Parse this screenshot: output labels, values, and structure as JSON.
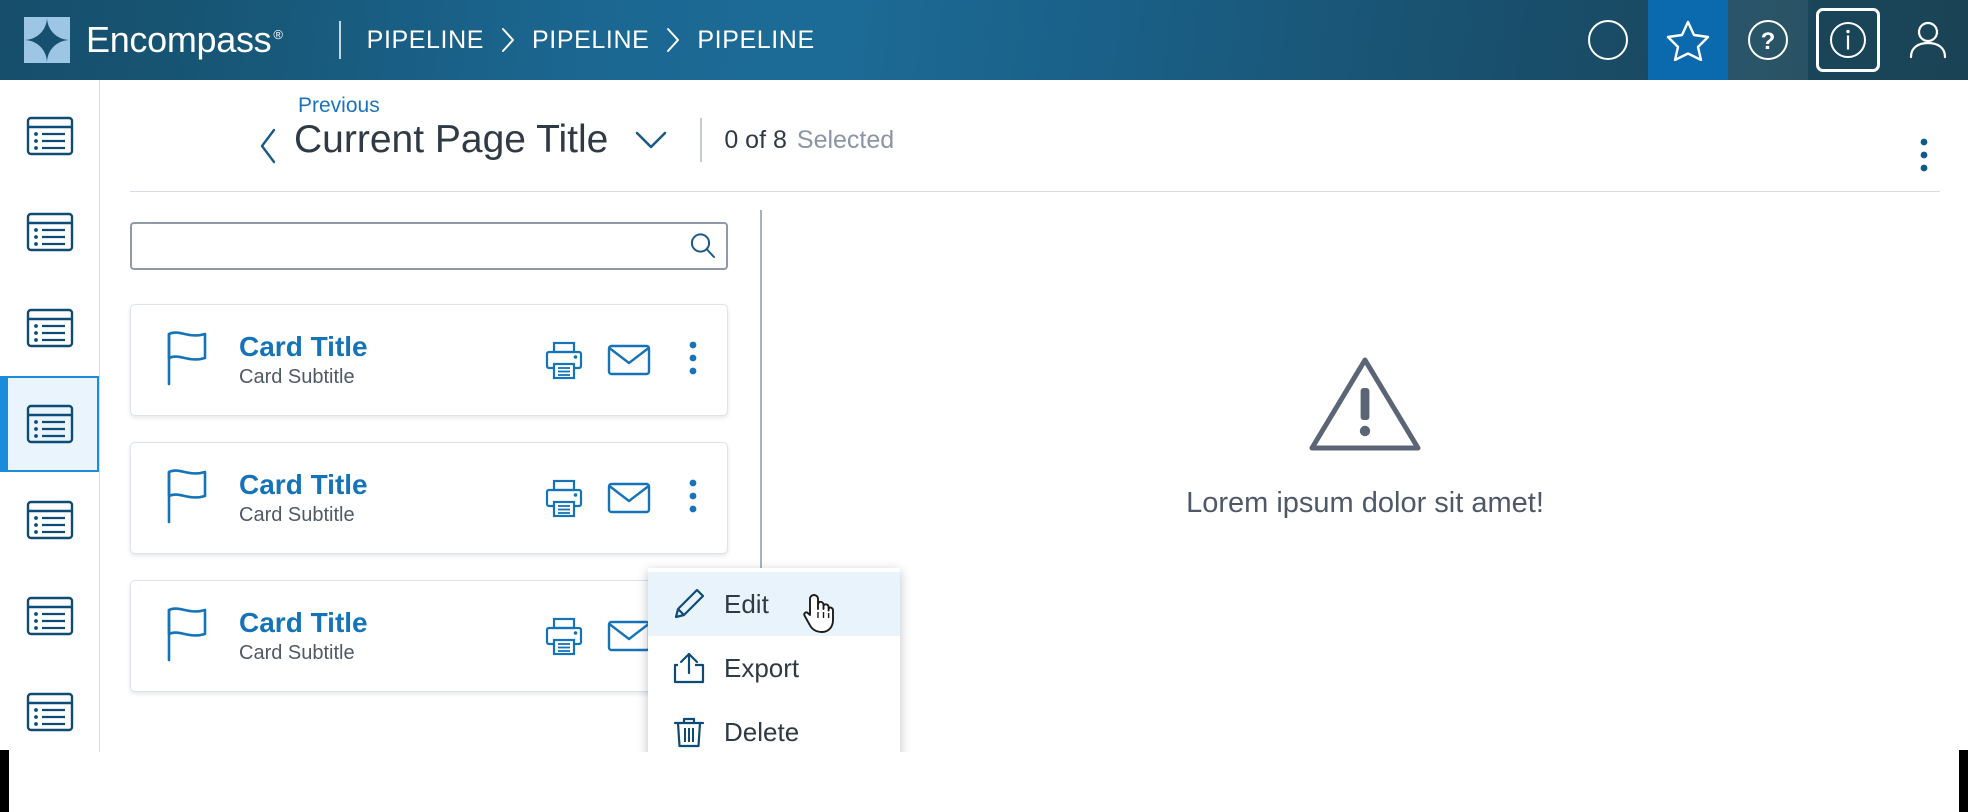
{
  "app": {
    "brand_name": "Encompass",
    "brand_registered": "®",
    "logo_icon": "four-point-star-logo"
  },
  "topbar": {
    "breadcrumb": [
      {
        "label": "PIPELINE"
      },
      {
        "label": "PIPELINE"
      },
      {
        "label": "PIPELINE"
      }
    ],
    "separator_icon": "chevron-right-icon",
    "actions": [
      {
        "name": "circle-icon",
        "label": "",
        "active": false
      },
      {
        "name": "star-icon",
        "label": "",
        "active": true
      },
      {
        "name": "help-icon",
        "label": "?",
        "active": false
      },
      {
        "name": "info-icon",
        "label": "i",
        "active": false
      },
      {
        "name": "user-icon",
        "label": "",
        "active": false
      }
    ],
    "colors": {
      "gradient_left": "#164e6b",
      "gradient_mid": "#1c6b97",
      "gradient_right": "#1b4356",
      "star_tile": "#0b6aad",
      "logo_tile": "#9dc6e4"
    }
  },
  "sidebar": {
    "items": [
      {
        "icon": "list-view-icon",
        "active": false
      },
      {
        "icon": "list-view-icon",
        "active": false
      },
      {
        "icon": "list-view-icon",
        "active": false
      },
      {
        "icon": "list-view-icon",
        "active": true
      },
      {
        "icon": "list-view-icon",
        "active": false
      },
      {
        "icon": "list-view-icon",
        "active": false
      },
      {
        "icon": "list-view-icon",
        "active": false
      }
    ],
    "active_color": "#1b8cdb",
    "active_bg": "#eaf4fc"
  },
  "page_header": {
    "previous_label": "Previous",
    "title": "Current Page Title",
    "title_caret_icon": "chevron-down-icon",
    "back_icon": "chevron-left-icon",
    "selected_count": "0 of 8",
    "selected_word": "Selected",
    "kebab_icon": "more-vertical-icon"
  },
  "search": {
    "value": "",
    "placeholder": "",
    "icon": "search-icon"
  },
  "cards": [
    {
      "flag_icon": "flag-icon",
      "title": "Card Title",
      "subtitle": "Card Subtitle",
      "print_icon": "printer-icon",
      "mail_icon": "envelope-icon",
      "kebab_icon": "more-vertical-icon"
    },
    {
      "flag_icon": "flag-icon",
      "title": "Card Title",
      "subtitle": "Card Subtitle",
      "print_icon": "printer-icon",
      "mail_icon": "envelope-icon",
      "kebab_icon": "more-vertical-icon"
    },
    {
      "flag_icon": "flag-icon",
      "title": "Card Title",
      "subtitle": "Card Subtitle",
      "print_icon": "printer-icon",
      "mail_icon": "envelope-icon",
      "kebab_icon": "more-vertical-icon"
    }
  ],
  "context_menu": {
    "items": [
      {
        "label": "Edit",
        "icon": "pencil-icon",
        "highlighted": true
      },
      {
        "label": "Export",
        "icon": "export-icon",
        "highlighted": false
      },
      {
        "label": "Delete",
        "icon": "trash-icon",
        "highlighted": false
      }
    ]
  },
  "empty_state": {
    "icon": "warning-triangle-icon",
    "message": "Lorem ipsum dolor sit amet!",
    "color": "#5b6576"
  },
  "colors": {
    "card_title": "#1573b8",
    "link": "#1b74bb",
    "icon_blue": "#1573b8",
    "icon_navy": "#0f4c75",
    "text_dark": "#2f3a45",
    "text_muted": "#8b95a3"
  }
}
